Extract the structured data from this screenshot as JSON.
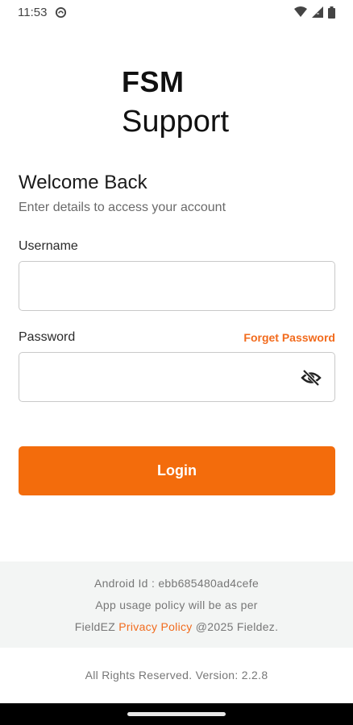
{
  "status_bar": {
    "time": "11:53",
    "icons": [
      "sync-icon",
      "wifi-icon",
      "signal-icon",
      "battery-icon"
    ]
  },
  "logo": {
    "title": "FSM",
    "subtitle": "Support"
  },
  "welcome": {
    "heading": "Welcome Back",
    "subheading": "Enter details to access your account"
  },
  "form": {
    "username_label": "Username",
    "username_value": "",
    "password_label": "Password",
    "password_value": "",
    "forgot_label": "Forget Password",
    "password_visibility_icon": "eye-off-icon",
    "login_label": "Login"
  },
  "footer": {
    "android_id": "Android Id : ebb685480ad4cefe",
    "policy_line": "App usage policy will be as per",
    "policy_prefix": "FieldEZ ",
    "privacy_link": "Privacy Policy",
    "policy_suffix": " @2025 Fieldez."
  },
  "rights": "All Rights Reserved. Version: 2.2.8",
  "colors": {
    "accent": "#f36c0c",
    "link": "#f26b1d",
    "footer_bg": "#f3f5f4"
  }
}
